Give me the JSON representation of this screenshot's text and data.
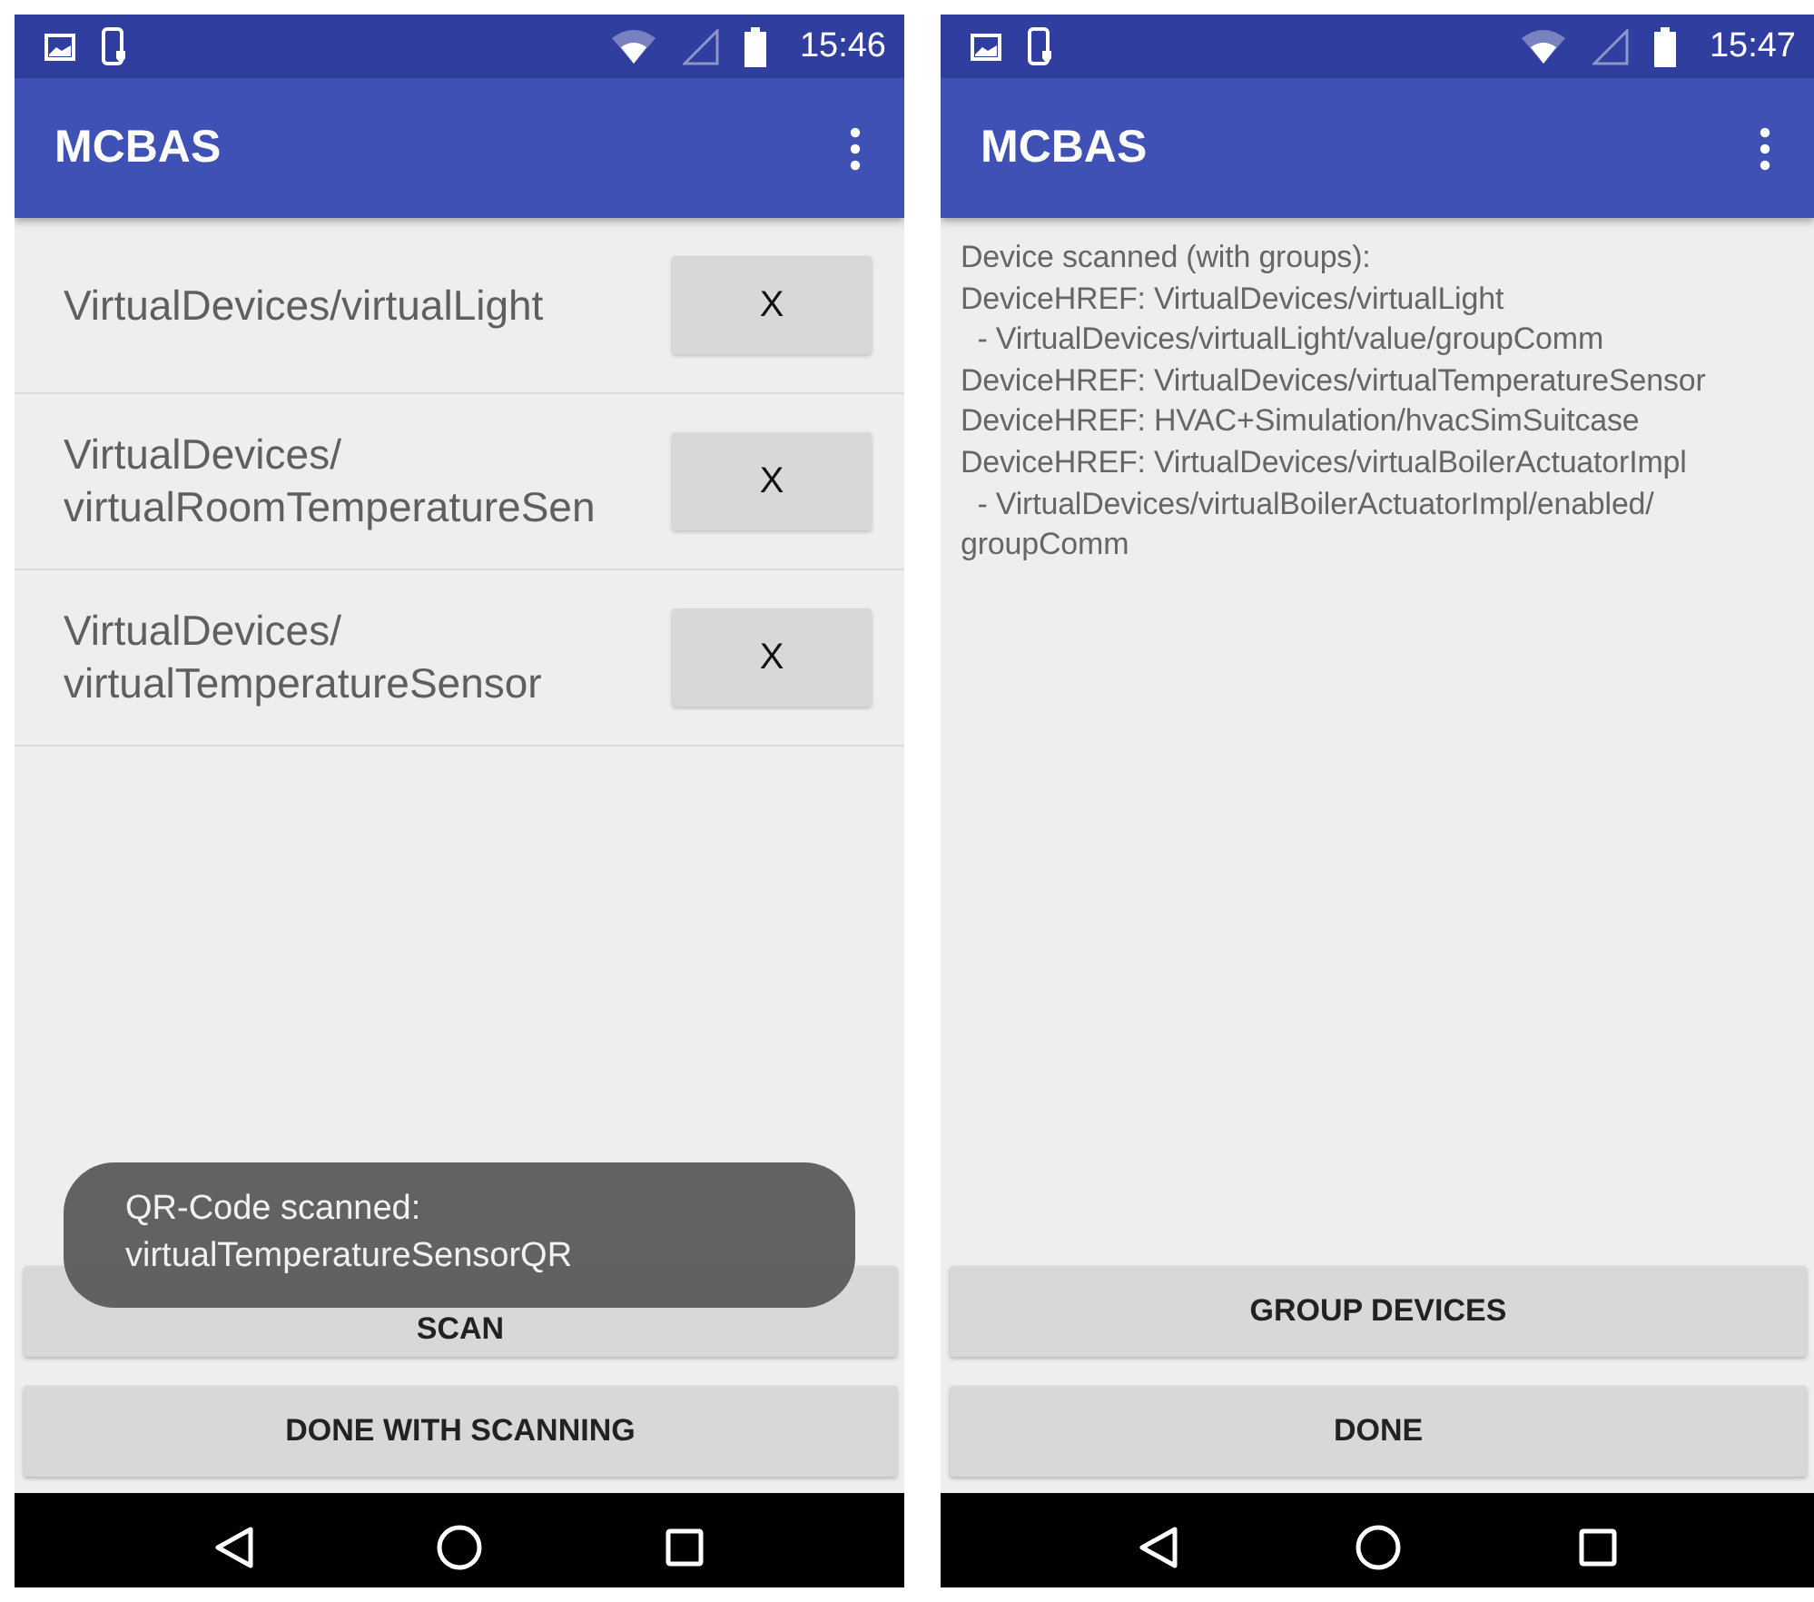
{
  "screens": [
    {
      "kind": "device_list",
      "status_bar": {
        "time": "15:46"
      },
      "app_bar": {
        "title": "MCBAS"
      },
      "devices": [
        {
          "name": "VirtualDevices/virtualLight",
          "remove_label": "X"
        },
        {
          "name": "VirtualDevices/\nvirtualRoomTemperatureSen",
          "remove_label": "X"
        },
        {
          "name": "VirtualDevices/\nvirtualTemperatureSensor",
          "remove_label": "X"
        }
      ],
      "buttons": [
        "SCAN",
        "DONE WITH SCANNING"
      ],
      "toast": "QR-Code scanned:\nvirtualTemperatureSensorQR"
    },
    {
      "kind": "scan_result",
      "status_bar": {
        "time": "15:47"
      },
      "app_bar": {
        "title": "MCBAS"
      },
      "result_text": "Device scanned (with groups):\nDeviceHREF: VirtualDevices/virtualLight\n  - VirtualDevices/virtualLight/value/groupComm\nDeviceHREF: VirtualDevices/virtualTemperatureSensor\nDeviceHREF: HVAC+Simulation/hvacSimSuitcase\nDeviceHREF: VirtualDevices/virtualBoilerActuatorImpl\n  - VirtualDevices/virtualBoilerActuatorImpl/enabled/\ngroupComm",
      "buttons": [
        "GROUP DEVICES",
        "DONE"
      ]
    }
  ]
}
